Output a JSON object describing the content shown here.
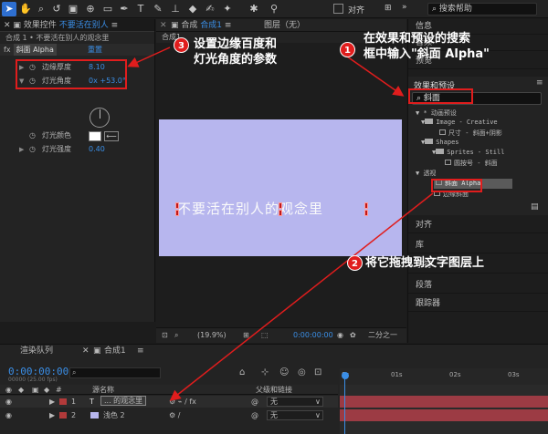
{
  "toolbar": {
    "snap_label": "对齐",
    "search_placeholder": "搜索帮助"
  },
  "effect_controls": {
    "tab_title": "效果控件",
    "tab_layer": "不要活在别人",
    "breadcrumb": "合成 1 • 不要活在别人的观念里",
    "effect_name": "斜面 Alpha",
    "reset_label": "重置",
    "properties": [
      {
        "name": "边缘厚度",
        "value": "8.10"
      },
      {
        "name": "灯光角度",
        "value": "0x +53.0°"
      },
      {
        "name": "灯光颜色",
        "value": ""
      },
      {
        "name": "灯光强度",
        "value": "0.40"
      }
    ]
  },
  "composition": {
    "tab_label": "合成",
    "tab_name": "合成1",
    "tab_layers": "图层（无）",
    "sub_label": "合成1",
    "canvas_text": "不要活在别人的观念里",
    "zoom": "(19.9%)",
    "timecode": "0:00:00:00",
    "resolution": "二分之一"
  },
  "right_panel": {
    "info": "信息",
    "audio": "音频",
    "preview": "预览",
    "effects_presets_title": "效果和预设",
    "search_value": "斜面",
    "tree": [
      {
        "label": "* 动画预设",
        "depth": 0
      },
      {
        "label": "Image - Creative",
        "depth": 1
      },
      {
        "label": "尺寸 - 斜面+阴影",
        "depth": 2
      },
      {
        "label": "Shapes",
        "depth": 1
      },
      {
        "label": "Sprites - Still",
        "depth": 2
      },
      {
        "label": "圆按号 - 斜面",
        "depth": 3
      },
      {
        "label": "透视",
        "depth": 0
      },
      {
        "label": "斜面 Alpha",
        "depth": 1
      },
      {
        "label": "边缘斜面",
        "depth": 1
      }
    ],
    "align": "对齐",
    "library": "库",
    "characters": "字符",
    "paragraphs": "段落",
    "tracker": "跟踪器"
  },
  "timeline": {
    "tab_render": "渲染队列",
    "tab_comp": "合成1",
    "current_time": "0:00:00:00",
    "fps": "00000 (25.00 fps)",
    "col_name": "源名称",
    "col_parent": "父级和链接",
    "ruler_ticks": [
      "0s",
      "01s",
      "02s",
      "03s"
    ],
    "layers": [
      {
        "index": "1",
        "type": "T",
        "name": "... 的观念里",
        "parent": "无",
        "color": "#b23a3a"
      },
      {
        "index": "2",
        "type": "",
        "name": "浅色 2",
        "parent": "无",
        "color": "#b23a3a"
      }
    ]
  },
  "annotations": {
    "step1_number": "1",
    "step1_text_line1": "在效果和预设的搜索",
    "step1_text_line2": "框中输入\"斜面 Alpha\"",
    "step2_number": "2",
    "step2_text": "将它拖拽到文字图层上",
    "step3_number": "3",
    "step3_text_line1": "设置边缘百度和",
    "step3_text_line2": "灯光角度的参数"
  },
  "colors": {
    "accent_blue": "#3a8ee6",
    "annotation_red": "#e01d1d",
    "canvas_lavender": "#b7b6ee",
    "track_bar": "#9c3b44"
  }
}
